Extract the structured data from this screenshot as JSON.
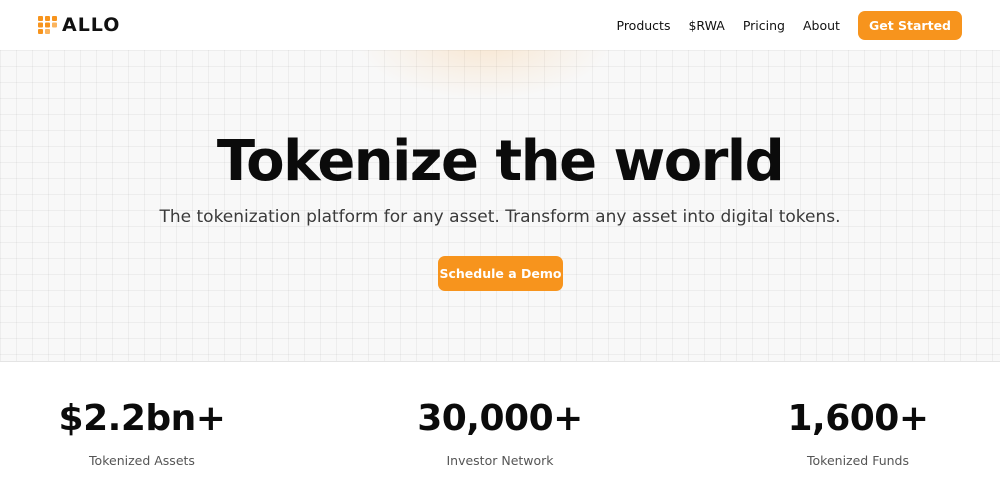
{
  "brand": {
    "name": "ALLO",
    "icon": "allo-logo-grid-icon",
    "accent": "#f7941d"
  },
  "nav": {
    "links": [
      "Products",
      "$RWA",
      "Pricing",
      "About"
    ],
    "cta": "Get Started"
  },
  "hero": {
    "title": "Tokenize the world",
    "subtitle": "The tokenization platform for any asset. Transform any asset into digital tokens.",
    "cta": "Schedule a Demo"
  },
  "stats": [
    {
      "value": "$2.2bn+",
      "label": "Tokenized Assets"
    },
    {
      "value": "30,000+",
      "label": "Investor Network"
    },
    {
      "value": "1,600+",
      "label": "Tokenized Funds"
    }
  ]
}
